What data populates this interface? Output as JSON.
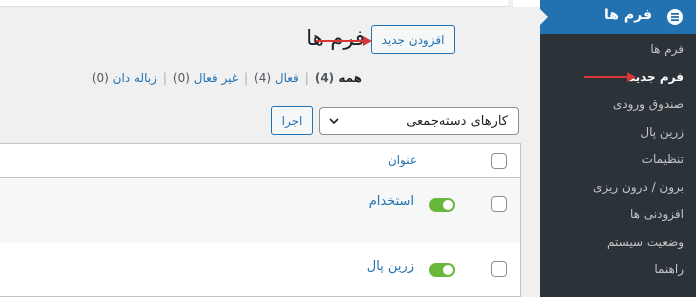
{
  "page": {
    "title": "فرم ها",
    "add_new_label": "افزودن جدید"
  },
  "filters": [
    {
      "label": "همه",
      "count": "(4)"
    },
    {
      "label": "فعال",
      "count": "(4)"
    },
    {
      "label": "غیر فعال",
      "count": "(0)"
    },
    {
      "label": "زباله دان",
      "count": "(0)"
    }
  ],
  "bulk_actions": {
    "selected": "کارهای دسته‌جمعی",
    "apply_label": "اجرا"
  },
  "table": {
    "column_title": "عنوان",
    "rows": [
      {
        "title": "استخدام",
        "active": true
      },
      {
        "title": "زرین پال",
        "active": true
      }
    ]
  },
  "sidebar": {
    "menu_title": "فرم ها",
    "items": [
      {
        "label": "فرم ها"
      },
      {
        "label": "فرم جدید"
      },
      {
        "label": "صندوق ورودی"
      },
      {
        "label": "زرین پال"
      },
      {
        "label": "تنظیمات"
      },
      {
        "label": "برون / درون ریزی"
      },
      {
        "label": "افزودنی ها"
      },
      {
        "label": "وضعیت سیستم"
      },
      {
        "label": "راهنما"
      }
    ],
    "current_item": "فرم جدید"
  },
  "colors": {
    "accent": "#2271b1",
    "sidebar_bg": "#1d2327",
    "toggle_on": "#69b83c",
    "annotation_arrow": "#d63638"
  }
}
